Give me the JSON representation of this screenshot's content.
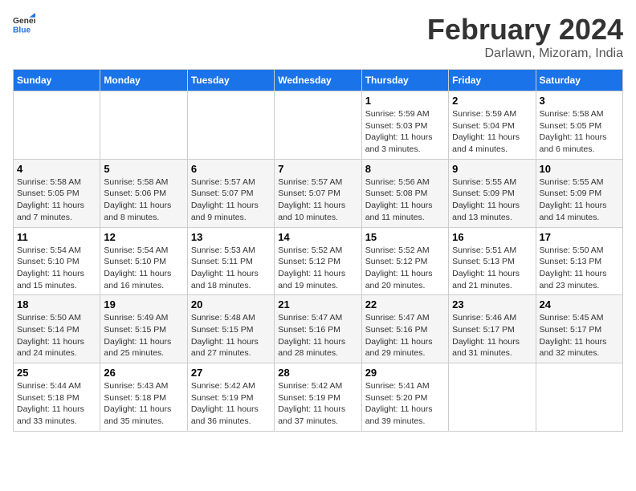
{
  "logo": {
    "line1": "General",
    "line2": "Blue"
  },
  "title": "February 2024",
  "subtitle": "Darlawn, Mizoram, India",
  "days_header": [
    "Sunday",
    "Monday",
    "Tuesday",
    "Wednesday",
    "Thursday",
    "Friday",
    "Saturday"
  ],
  "weeks": [
    [
      {
        "num": "",
        "info": ""
      },
      {
        "num": "",
        "info": ""
      },
      {
        "num": "",
        "info": ""
      },
      {
        "num": "",
        "info": ""
      },
      {
        "num": "1",
        "info": "Sunrise: 5:59 AM\nSunset: 5:03 PM\nDaylight: 11 hours\nand 3 minutes."
      },
      {
        "num": "2",
        "info": "Sunrise: 5:59 AM\nSunset: 5:04 PM\nDaylight: 11 hours\nand 4 minutes."
      },
      {
        "num": "3",
        "info": "Sunrise: 5:58 AM\nSunset: 5:05 PM\nDaylight: 11 hours\nand 6 minutes."
      }
    ],
    [
      {
        "num": "4",
        "info": "Sunrise: 5:58 AM\nSunset: 5:05 PM\nDaylight: 11 hours\nand 7 minutes."
      },
      {
        "num": "5",
        "info": "Sunrise: 5:58 AM\nSunset: 5:06 PM\nDaylight: 11 hours\nand 8 minutes."
      },
      {
        "num": "6",
        "info": "Sunrise: 5:57 AM\nSunset: 5:07 PM\nDaylight: 11 hours\nand 9 minutes."
      },
      {
        "num": "7",
        "info": "Sunrise: 5:57 AM\nSunset: 5:07 PM\nDaylight: 11 hours\nand 10 minutes."
      },
      {
        "num": "8",
        "info": "Sunrise: 5:56 AM\nSunset: 5:08 PM\nDaylight: 11 hours\nand 11 minutes."
      },
      {
        "num": "9",
        "info": "Sunrise: 5:55 AM\nSunset: 5:09 PM\nDaylight: 11 hours\nand 13 minutes."
      },
      {
        "num": "10",
        "info": "Sunrise: 5:55 AM\nSunset: 5:09 PM\nDaylight: 11 hours\nand 14 minutes."
      }
    ],
    [
      {
        "num": "11",
        "info": "Sunrise: 5:54 AM\nSunset: 5:10 PM\nDaylight: 11 hours\nand 15 minutes."
      },
      {
        "num": "12",
        "info": "Sunrise: 5:54 AM\nSunset: 5:10 PM\nDaylight: 11 hours\nand 16 minutes."
      },
      {
        "num": "13",
        "info": "Sunrise: 5:53 AM\nSunset: 5:11 PM\nDaylight: 11 hours\nand 18 minutes."
      },
      {
        "num": "14",
        "info": "Sunrise: 5:52 AM\nSunset: 5:12 PM\nDaylight: 11 hours\nand 19 minutes."
      },
      {
        "num": "15",
        "info": "Sunrise: 5:52 AM\nSunset: 5:12 PM\nDaylight: 11 hours\nand 20 minutes."
      },
      {
        "num": "16",
        "info": "Sunrise: 5:51 AM\nSunset: 5:13 PM\nDaylight: 11 hours\nand 21 minutes."
      },
      {
        "num": "17",
        "info": "Sunrise: 5:50 AM\nSunset: 5:13 PM\nDaylight: 11 hours\nand 23 minutes."
      }
    ],
    [
      {
        "num": "18",
        "info": "Sunrise: 5:50 AM\nSunset: 5:14 PM\nDaylight: 11 hours\nand 24 minutes."
      },
      {
        "num": "19",
        "info": "Sunrise: 5:49 AM\nSunset: 5:15 PM\nDaylight: 11 hours\nand 25 minutes."
      },
      {
        "num": "20",
        "info": "Sunrise: 5:48 AM\nSunset: 5:15 PM\nDaylight: 11 hours\nand 27 minutes."
      },
      {
        "num": "21",
        "info": "Sunrise: 5:47 AM\nSunset: 5:16 PM\nDaylight: 11 hours\nand 28 minutes."
      },
      {
        "num": "22",
        "info": "Sunrise: 5:47 AM\nSunset: 5:16 PM\nDaylight: 11 hours\nand 29 minutes."
      },
      {
        "num": "23",
        "info": "Sunrise: 5:46 AM\nSunset: 5:17 PM\nDaylight: 11 hours\nand 31 minutes."
      },
      {
        "num": "24",
        "info": "Sunrise: 5:45 AM\nSunset: 5:17 PM\nDaylight: 11 hours\nand 32 minutes."
      }
    ],
    [
      {
        "num": "25",
        "info": "Sunrise: 5:44 AM\nSunset: 5:18 PM\nDaylight: 11 hours\nand 33 minutes."
      },
      {
        "num": "26",
        "info": "Sunrise: 5:43 AM\nSunset: 5:18 PM\nDaylight: 11 hours\nand 35 minutes."
      },
      {
        "num": "27",
        "info": "Sunrise: 5:42 AM\nSunset: 5:19 PM\nDaylight: 11 hours\nand 36 minutes."
      },
      {
        "num": "28",
        "info": "Sunrise: 5:42 AM\nSunset: 5:19 PM\nDaylight: 11 hours\nand 37 minutes."
      },
      {
        "num": "29",
        "info": "Sunrise: 5:41 AM\nSunset: 5:20 PM\nDaylight: 11 hours\nand 39 minutes."
      },
      {
        "num": "",
        "info": ""
      },
      {
        "num": "",
        "info": ""
      }
    ]
  ]
}
